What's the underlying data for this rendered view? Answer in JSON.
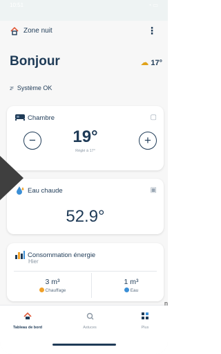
{
  "status": {
    "time": "10:51",
    "icons": "◔ ▭"
  },
  "header": {
    "zone": "Zone nuit",
    "more": "⋮"
  },
  "greeting": "Bonjour",
  "weather": {
    "temperature": "17°"
  },
  "system": {
    "status": "Système OK"
  },
  "chambre": {
    "title": "Chambre",
    "temperature": "19°",
    "setpoint": "Réglé à 17°",
    "minus": "−",
    "plus": "+"
  },
  "eau": {
    "title": "Eau chaude",
    "temperature": "52.9°"
  },
  "conso": {
    "title": "Consommation énergie",
    "subtitle": "Hier",
    "left": {
      "value": "3 m³",
      "label": "Chauffage"
    },
    "right": {
      "value": "1 m³",
      "label": "Eau"
    }
  },
  "tabs": [
    {
      "label": "Tableau de bord"
    },
    {
      "label": "Astuces"
    },
    {
      "label": "Plus"
    }
  ],
  "edge_text": "n",
  "colors": {
    "primary": "#1f3b57",
    "accent_orange": "#f0a12a",
    "accent_blue": "#3b8fd6",
    "background": "#f7f7f7"
  }
}
